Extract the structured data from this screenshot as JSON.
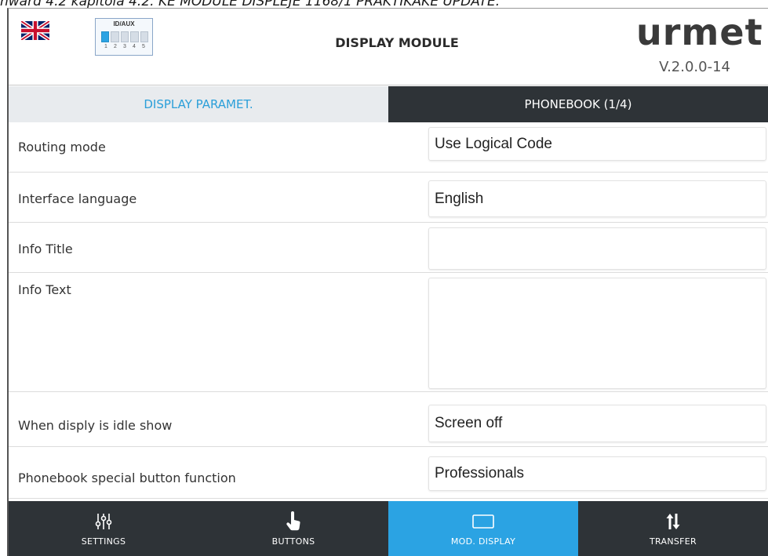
{
  "document": {
    "caption": "nward 4.2 kapitola 4.2. KE MODULE DISPLEJE 1168/1 PRAKTIKAKE UPDATE."
  },
  "header": {
    "flag": "uk-flag",
    "dip": {
      "label": "ID/AUX",
      "numbers": [
        "1",
        "2",
        "3",
        "4",
        "5"
      ],
      "active_switch": 1
    },
    "title": "DISPLAY MODULE",
    "brand": "urmet",
    "version": "V.2.0.0-14"
  },
  "tabs": [
    {
      "label": "DISPLAY PARAMET.",
      "active": true
    },
    {
      "label": "PHONEBOOK (1/4)",
      "active": false
    }
  ],
  "params": [
    {
      "label": "Routing mode",
      "value": "Use Logical Code"
    },
    {
      "label": "Interface language",
      "value": "English"
    },
    {
      "label": "Info Title",
      "value": ""
    },
    {
      "label": "Info Text",
      "value": ""
    },
    {
      "label": "When disply is idle show",
      "value": "Screen off"
    },
    {
      "label": "Phonebook special button function",
      "value": "Professionals"
    }
  ],
  "nav": [
    {
      "label": "SETTINGS",
      "icon": "sliders-icon",
      "active": false
    },
    {
      "label": "BUTTONS",
      "icon": "hand-pointer-icon",
      "active": false
    },
    {
      "label": "MOD. DISPLAY",
      "icon": "display-icon",
      "active": true
    },
    {
      "label": "TRANSFER",
      "icon": "transfer-arrows-icon",
      "active": false
    }
  ],
  "colors": {
    "accent": "#2ba3e3",
    "dark": "#2e3337",
    "tab_active_text": "#2b9fd9"
  }
}
